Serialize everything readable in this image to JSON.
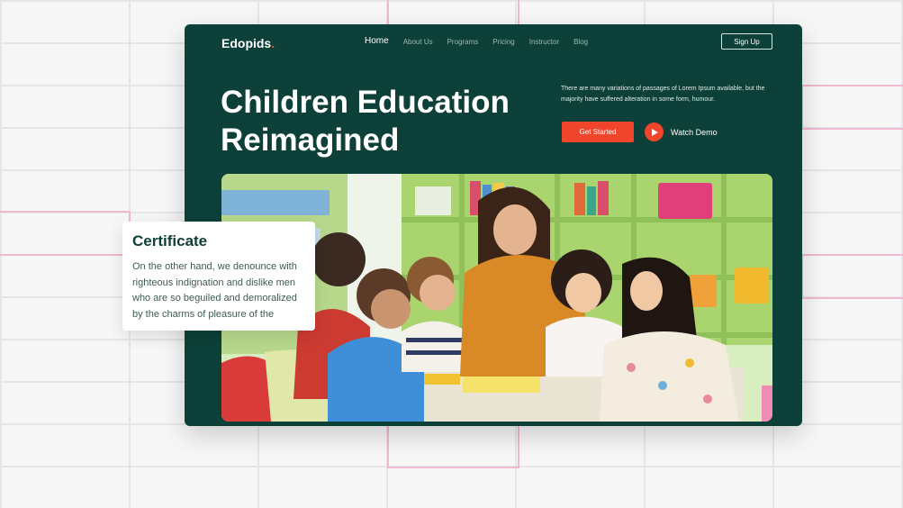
{
  "brand": {
    "name": "Edopids",
    "dot": ".",
    "accent": "#f14a2c",
    "card_bg": "#0c4038"
  },
  "nav": {
    "items": [
      {
        "label": "Home",
        "active": true
      },
      {
        "label": "About Us"
      },
      {
        "label": "Programs"
      },
      {
        "label": "Pricing"
      },
      {
        "label": "Instructor"
      },
      {
        "label": "Blog"
      }
    ],
    "signup_label": "Sign Up"
  },
  "hero": {
    "headline_line1": "Children Education",
    "headline_line2": "Reimagined",
    "description": "There are many variations of passages of Lorem Ipsum available, but the majority have suffered alteration in some form, humour.",
    "get_started_label": "Get Started",
    "watch_demo_label": "Watch Demo",
    "play_icon": "play-icon",
    "image": "teacher-reading-with-children-photo"
  },
  "certificate": {
    "title": "Certificate",
    "body": "On the other hand, we denounce with righteous indignation and dislike men who are so beguiled and demoralized by the charms of pleasure of the"
  }
}
